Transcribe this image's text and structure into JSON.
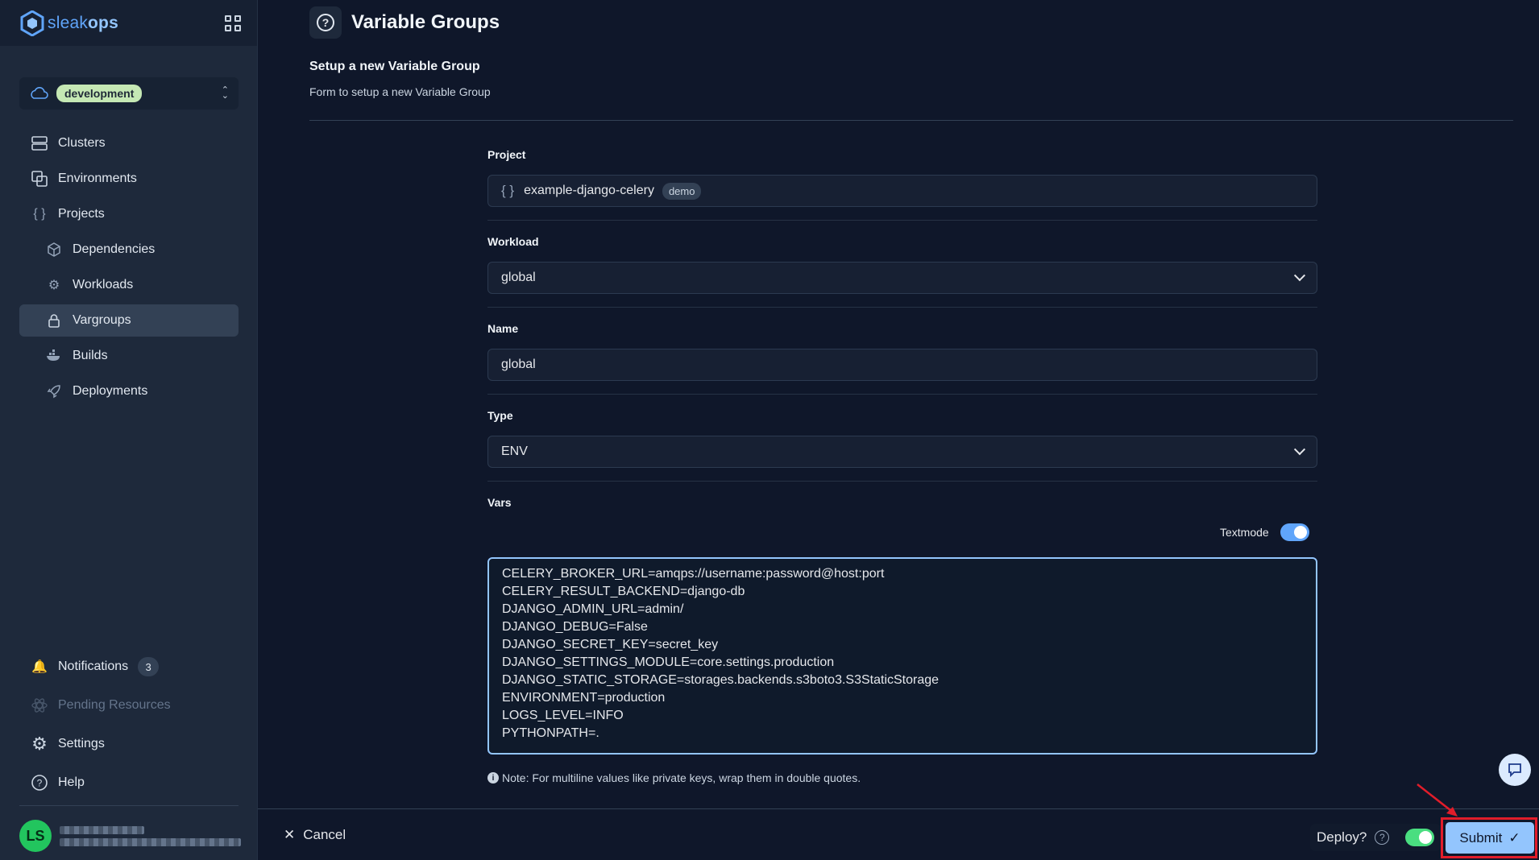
{
  "app": {
    "logo_prefix": "sleak",
    "logo_suffix": "ops"
  },
  "environment": {
    "selected": "development"
  },
  "sidebar": {
    "items": [
      {
        "label": "Clusters",
        "icon": "server-icon"
      },
      {
        "label": "Environments",
        "icon": "copy-icon"
      },
      {
        "label": "Projects",
        "icon": "braces-icon"
      },
      {
        "label": "Dependencies",
        "icon": "cube-icon"
      },
      {
        "label": "Workloads",
        "icon": "gears-icon"
      },
      {
        "label": "Vargroups",
        "icon": "lock-icon"
      },
      {
        "label": "Builds",
        "icon": "docker-icon"
      },
      {
        "label": "Deployments",
        "icon": "rocket-icon"
      }
    ],
    "bottom": {
      "notifications_label": "Notifications",
      "notifications_count": "3",
      "pending_label": "Pending Resources",
      "settings_label": "Settings",
      "help_label": "Help"
    },
    "user": {
      "initials": "LS"
    }
  },
  "page": {
    "title": "Variable Groups",
    "form_title": "Setup a new Variable Group",
    "form_subtitle": "Form to setup a new Variable Group"
  },
  "form": {
    "project_label": "Project",
    "project_value": "example-django-celery",
    "project_badge": "demo",
    "workload_label": "Workload",
    "workload_value": "global",
    "name_label": "Name",
    "name_value": "global",
    "type_label": "Type",
    "type_value": "ENV",
    "vars_label": "Vars",
    "textmode_label": "Textmode",
    "textmode_on": true,
    "vars_text": "CELERY_BROKER_URL=amqps://username:password@host:port\nCELERY_RESULT_BACKEND=django-db\nDJANGO_ADMIN_URL=admin/\nDJANGO_DEBUG=False\nDJANGO_SECRET_KEY=secret_key\nDJANGO_SETTINGS_MODULE=core.settings.production\nDJANGO_STATIC_STORAGE=storages.backends.s3boto3.S3StaticStorage\nENVIRONMENT=production\nLOGS_LEVEL=INFO\nPYTHONPATH=.",
    "note": "Note: For multiline values like private keys, wrap them in double quotes."
  },
  "footer": {
    "cancel_label": "Cancel",
    "deploy_label": "Deploy?",
    "deploy_on": true,
    "submit_label": "Submit"
  },
  "colors": {
    "accent": "#93c5fd",
    "env_badge": "#c5e8b4",
    "toggle_green": "#4ade80",
    "highlight_red": "#e11d2a"
  }
}
